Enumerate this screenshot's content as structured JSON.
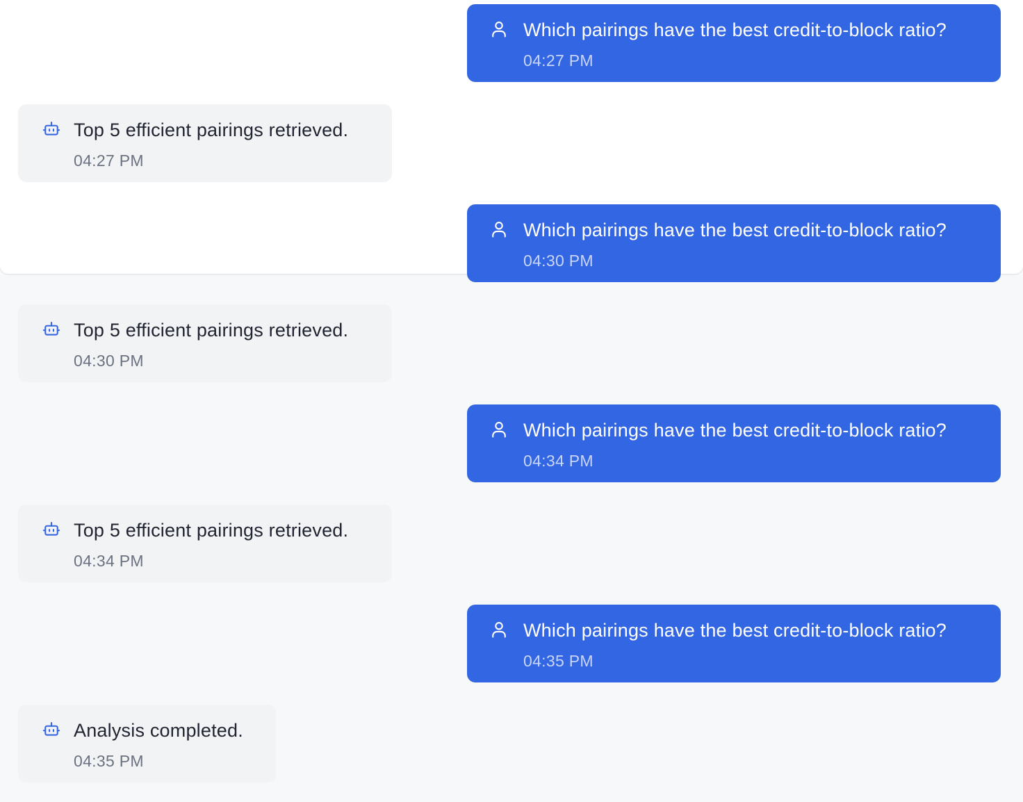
{
  "colors": {
    "user_bubble": "#3366e3",
    "bot_bubble": "#f2f3f5",
    "bot_icon": "#3366e3"
  },
  "messages": [
    {
      "role": "user",
      "icon": "user-icon",
      "text": "Which pairings have the best credit-to-block ratio?",
      "time": "04:27 PM"
    },
    {
      "role": "bot",
      "icon": "bot-icon",
      "text": "Top 5 efficient pairings retrieved.",
      "time": "04:27 PM"
    },
    {
      "role": "user",
      "icon": "user-icon",
      "text": "Which pairings have the best credit-to-block ratio?",
      "time": "04:30 PM"
    },
    {
      "role": "bot",
      "icon": "bot-icon",
      "text": "Top 5 efficient pairings retrieved.",
      "time": "04:30 PM"
    },
    {
      "role": "user",
      "icon": "user-icon",
      "text": "Which pairings have the best credit-to-block ratio?",
      "time": "04:34 PM"
    },
    {
      "role": "bot",
      "icon": "bot-icon",
      "text": "Top 5 efficient pairings retrieved.",
      "time": "04:34 PM"
    },
    {
      "role": "user",
      "icon": "user-icon",
      "text": "Which pairings have the best credit-to-block ratio?",
      "time": "04:35 PM"
    },
    {
      "role": "bot",
      "icon": "bot-icon",
      "text": "Analysis completed.",
      "time": "04:35 PM"
    }
  ]
}
